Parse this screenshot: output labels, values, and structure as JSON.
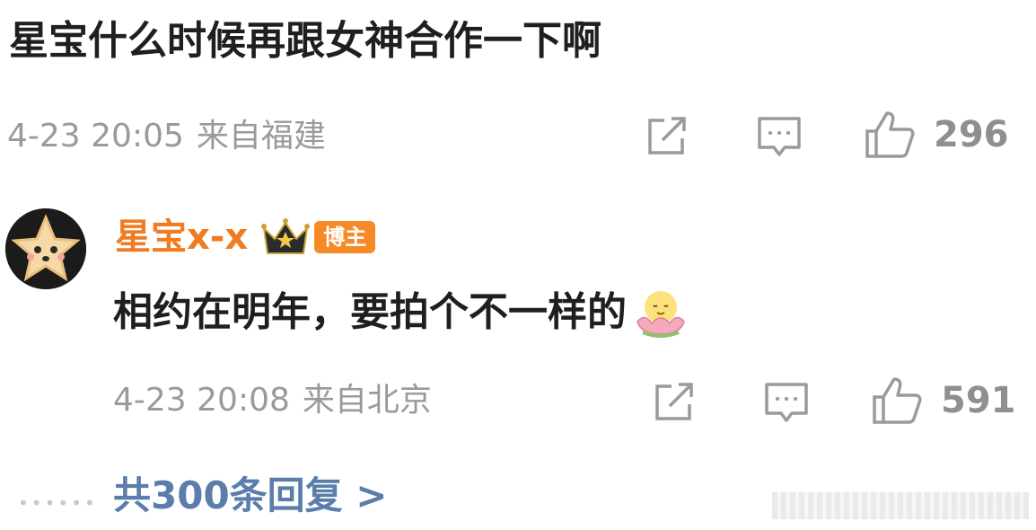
{
  "post": {
    "text": "星宝什么时候再跟女神合作一下啊",
    "time": "4-23 20:05",
    "location": "来自福建",
    "likes": "296"
  },
  "reply": {
    "username": "星宝x-x",
    "badge": "博主",
    "text": "相约在明年，要拍个不一样的",
    "emoji": "flower-smile-emoji",
    "time": "4-23 20:08",
    "location": "来自北京",
    "likes": "591"
  },
  "footer": {
    "more_replies": "共300条回复 >"
  },
  "icons": {
    "share": "share-icon",
    "comment": "comment-icon",
    "like": "thumbs-up-icon",
    "crown": "crown-icon"
  },
  "colors": {
    "username": "#f07b22",
    "link": "#5a7dab",
    "meta": "#9a9a9a",
    "badge": "#f58a26"
  }
}
